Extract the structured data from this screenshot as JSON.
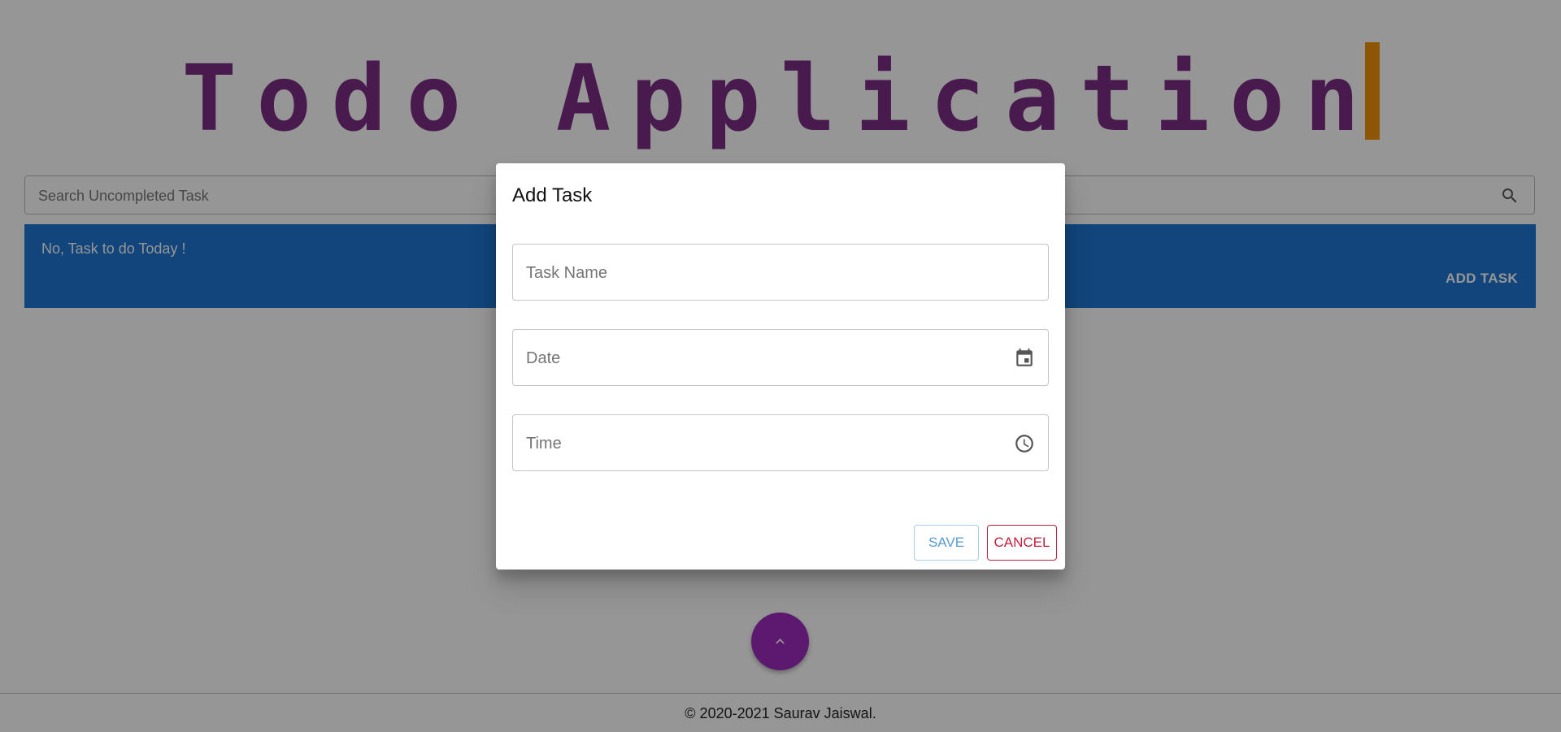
{
  "app": {
    "title": "Todo Application",
    "title_color": "#7b2d83",
    "cursor_color": "#f0920c"
  },
  "search": {
    "placeholder": "Search Uncompleted Task",
    "icon": "search-icon"
  },
  "banner": {
    "message": "No, Task to do Today !",
    "add_task_label": "ADD TASK",
    "color": "#1d76d2"
  },
  "fab": {
    "icon": "chevron-up-icon",
    "color": "#9c2bbd"
  },
  "footer": {
    "text": "© 2020-2021 Saurav Jaiswal."
  },
  "dialog": {
    "title": "Add Task",
    "fields": {
      "task_name": {
        "placeholder": "Task Name",
        "value": ""
      },
      "date": {
        "placeholder": "Date",
        "value": "",
        "icon": "calendar-icon"
      },
      "time": {
        "placeholder": "Time",
        "value": "",
        "icon": "clock-icon"
      }
    },
    "save_label": "SAVE",
    "cancel_label": "CANCEL",
    "save_color": "#5a9bd4",
    "cancel_color": "#c41f3c"
  }
}
